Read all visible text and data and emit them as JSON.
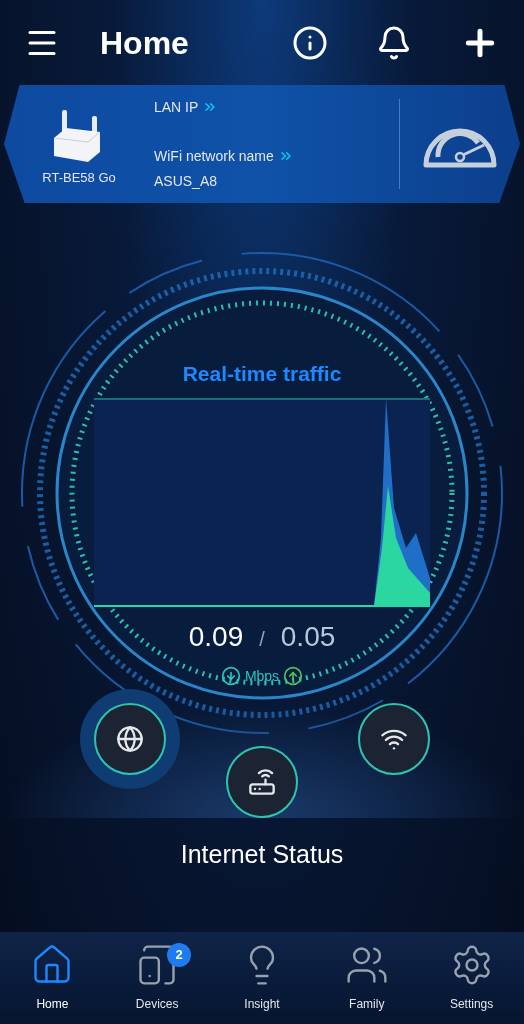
{
  "header": {
    "title": "Home"
  },
  "router_card": {
    "model": "RT-BE58 Go",
    "lan_ip_label": "LAN IP",
    "wifi_label": "WiFi network name",
    "wifi_name": "ASUS_A8"
  },
  "traffic": {
    "title": "Real-time traffic",
    "download": "0.09",
    "separator": "/",
    "upload": "0.05",
    "unit": "Mbps"
  },
  "status_buttons": [
    {
      "kind": "internet",
      "selected": true
    },
    {
      "kind": "router",
      "selected": false
    },
    {
      "kind": "wifi",
      "selected": false
    }
  ],
  "status_label": "Internet Status",
  "nav": [
    {
      "kind": "home",
      "label": "Home",
      "selected": true
    },
    {
      "kind": "devices",
      "label": "Devices",
      "selected": false,
      "badge": "2"
    },
    {
      "kind": "insight",
      "label": "Insight",
      "selected": false
    },
    {
      "kind": "family",
      "label": "Family",
      "selected": false
    },
    {
      "kind": "settings",
      "label": "Settings",
      "selected": false
    }
  ]
}
